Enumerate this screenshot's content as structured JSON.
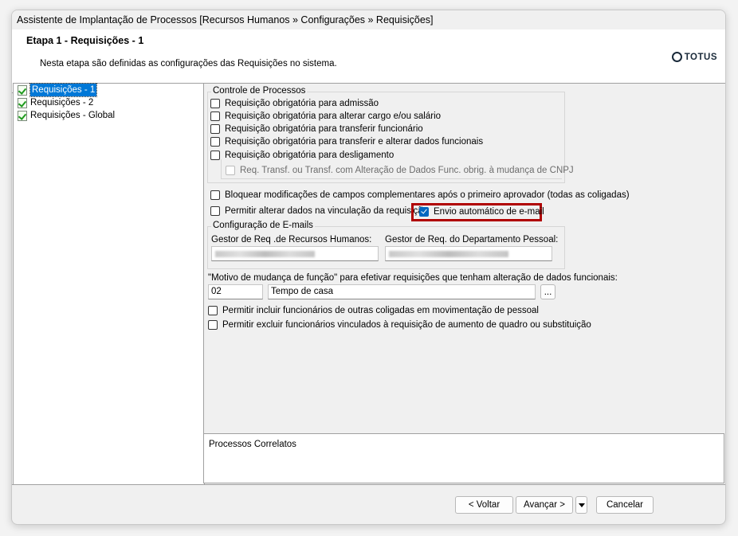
{
  "window": {
    "title": "Assistente de Implantação de Processos [Recursos Humanos » Configurações » Requisições]"
  },
  "header": {
    "step_title": "Etapa 1 - Requisições - 1",
    "description": "Nesta etapa são definidas as configurações das Requisições no sistema.",
    "logo": "TOTUS"
  },
  "tree": {
    "items": [
      {
        "label": "Requisições - 1",
        "selected": true
      },
      {
        "label": "Requisições - 2",
        "selected": false
      },
      {
        "label": "Requisições - Global",
        "selected": false
      }
    ]
  },
  "controle": {
    "title": "Controle de Processos",
    "items": [
      {
        "label": "Requisição obrigatória para admissão",
        "checked": false
      },
      {
        "label": "Requisição obrigatória para alterar cargo e/ou salário",
        "checked": false
      },
      {
        "label": "Requisição obrigatória para transferir funcionário",
        "checked": false
      },
      {
        "label": "Requisição obrigatória para transferir e alterar dados funcionais",
        "checked": false
      },
      {
        "label": "Requisição obrigatória para desligamento",
        "checked": false
      }
    ],
    "sub_item": {
      "label": "Req. Transf. ou Transf. com Alteração de Dados Func. obrig.  à mudança de CNPJ",
      "checked": false,
      "enabled": false
    }
  },
  "options": {
    "bloquear": "Bloquear modificações de campos complementares após o primeiro aprovador (todas as coligadas)",
    "permitir_alterar": "Permitir alterar dados na vinculação da requisição",
    "envio_email": {
      "label": "Envio automático de e-mail",
      "checked": true
    }
  },
  "emails": {
    "title": "Configuração de E-mails",
    "gestor_rh_label": "Gestor de Req .de Recursos Humanos:",
    "gestor_dp_label": "Gestor de Req. do Departamento Pessoal:"
  },
  "motivo": {
    "label": "\"Motivo de mudança de função\" para efetivar requisições que tenham alteração de dados funcionais:",
    "code": "02",
    "description": "Tempo de casa",
    "lookup_label": "..."
  },
  "extra": {
    "incluir": "Permitir incluir funcionários de outras coligadas em movimentação de pessoal",
    "excluir": "Permitir excluir funcionários vinculados à requisição de aumento de quadro ou substituição"
  },
  "bottom_panel": {
    "title": "Processos Correlatos"
  },
  "footer": {
    "back": "< Voltar",
    "next": "Avançar >",
    "cancel": "Cancelar"
  }
}
